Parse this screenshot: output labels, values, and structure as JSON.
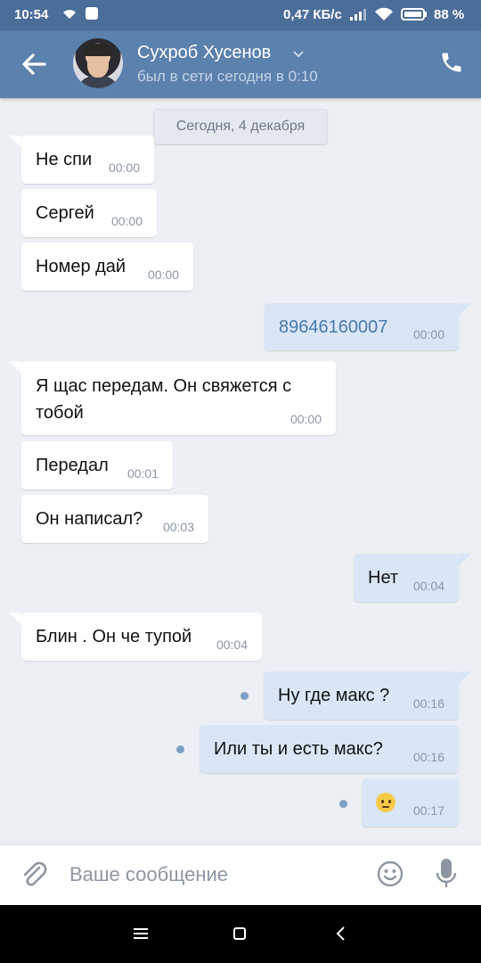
{
  "status_bar": {
    "time": "10:54",
    "speed": "0,47 КБ/с",
    "battery": "88 %"
  },
  "header": {
    "contact_name": "Сухроб Хусенов",
    "last_seen": "был в сети сегодня в 0:10"
  },
  "chat": {
    "date_label": "Сегодня, 4 декабря",
    "messages": [
      {
        "dir": "in",
        "text": "Не спи",
        "time": "00:00"
      },
      {
        "dir": "in",
        "text": "Сергей",
        "time": "00:00"
      },
      {
        "dir": "in",
        "text": "Номер дай",
        "time": "00:00"
      },
      {
        "dir": "out",
        "text": "89646160007",
        "time": "00:00"
      },
      {
        "dir": "in",
        "text": "Я щас передам.  Он свяжется с тобой",
        "time": "00:00"
      },
      {
        "dir": "in",
        "text": "Передал",
        "time": "00:01"
      },
      {
        "dir": "in",
        "text": "Он написал?",
        "time": "00:03"
      },
      {
        "dir": "out",
        "text": "Нет",
        "time": "00:04"
      },
      {
        "dir": "in",
        "text": "Блин . Он че тупой",
        "time": "00:04"
      },
      {
        "dir": "out",
        "text": "Ну где макс ?",
        "time": "00:16"
      },
      {
        "dir": "out",
        "text": "Или ты и есть макс?",
        "time": "00:16"
      },
      {
        "dir": "out",
        "text": "",
        "time": "00:17",
        "icon": "confused-emoji-icon"
      }
    ]
  },
  "composer": {
    "placeholder": "Ваше сообщение"
  },
  "colors": {
    "header": "#5b81ad",
    "status_bar": "#4b6e99",
    "incoming_bubble": "#ffffff",
    "outgoing_bubble": "#d9e6f6",
    "background": "#eceff3"
  }
}
